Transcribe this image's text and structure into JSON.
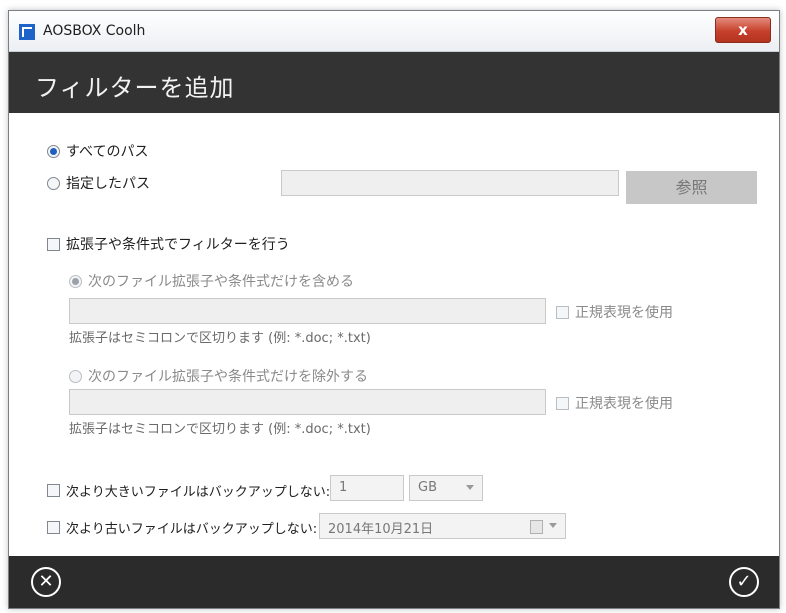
{
  "window": {
    "title": "AOSBOX Coolh",
    "close_symbol": "x"
  },
  "header": {
    "title": "フィルターを追加"
  },
  "path": {
    "all_paths_label": "すべてのパス",
    "specified_path_label": "指定したパス",
    "browse_label": "参照"
  },
  "filter": {
    "enable_label": "拡張子や条件式でフィルターを行う",
    "include_label": "次のファイル拡張子や条件式だけを含める",
    "exclude_label": "次のファイル拡張子や条件式だけを除外する",
    "regex_label": "正規表現を使用",
    "hint": "拡張子はセミコロンで区切ります (例: *.doc; *.txt)"
  },
  "size_limit": {
    "label": "次より大きいファイルはバックアップしない:",
    "value": "1",
    "unit": "GB"
  },
  "date_limit": {
    "label": "次より古いファイルはバックアップしない:",
    "value": "2014年10月21日"
  },
  "footer": {
    "cancel_symbol": "✕",
    "ok_symbol": "✓"
  }
}
